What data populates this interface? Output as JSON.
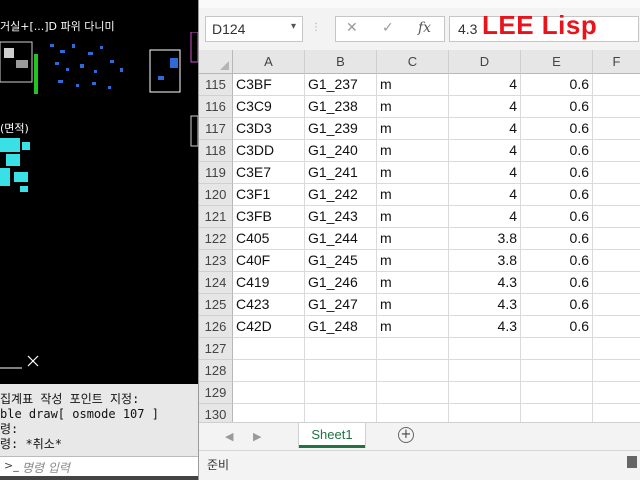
{
  "cad": {
    "top_label": "거실+[...]D 파위 다니미",
    "label2": "(면적)",
    "command_lines": [
      " 집계표 작성 포인트 지정:",
      "ble draw[ osmode 107 ]",
      "령:",
      "령: *취소*"
    ],
    "command_placeholder": "명령 입력",
    "command_icon": ">_",
    "close_icon_glyph": "✕"
  },
  "excel": {
    "name_box": "D124",
    "formula_value": "4.3",
    "watermark": "LEE Lisp",
    "columns": [
      "A",
      "B",
      "C",
      "D",
      "E",
      "F"
    ],
    "rows": [
      {
        "num": "115",
        "a": "C3BF",
        "b": "G1_237",
        "c": "m",
        "d": "4",
        "e": "0.6"
      },
      {
        "num": "116",
        "a": "C3C9",
        "b": "G1_238",
        "c": "m",
        "d": "4",
        "e": "0.6"
      },
      {
        "num": "117",
        "a": "C3D3",
        "b": "G1_239",
        "c": "m",
        "d": "4",
        "e": "0.6"
      },
      {
        "num": "118",
        "a": "C3DD",
        "b": "G1_240",
        "c": "m",
        "d": "4",
        "e": "0.6"
      },
      {
        "num": "119",
        "a": "C3E7",
        "b": "G1_241",
        "c": "m",
        "d": "4",
        "e": "0.6"
      },
      {
        "num": "120",
        "a": "C3F1",
        "b": "G1_242",
        "c": "m",
        "d": "4",
        "e": "0.6"
      },
      {
        "num": "121",
        "a": "C3FB",
        "b": "G1_243",
        "c": "m",
        "d": "4",
        "e": "0.6"
      },
      {
        "num": "122",
        "a": "C405",
        "b": "G1_244",
        "c": "m",
        "d": "3.8",
        "e": "0.6"
      },
      {
        "num": "123",
        "a": "C40F",
        "b": "G1_245",
        "c": "m",
        "d": "3.8",
        "e": "0.6"
      },
      {
        "num": "124",
        "a": "C419",
        "b": "G1_246",
        "c": "m",
        "d": "4.3",
        "e": "0.6"
      },
      {
        "num": "125",
        "a": "C423",
        "b": "G1_247",
        "c": "m",
        "d": "4.3",
        "e": "0.6"
      },
      {
        "num": "126",
        "a": "C42D",
        "b": "G1_248",
        "c": "m",
        "d": "4.3",
        "e": "0.6"
      },
      {
        "num": "127",
        "a": "",
        "b": "",
        "c": "",
        "d": "",
        "e": ""
      },
      {
        "num": "128",
        "a": "",
        "b": "",
        "c": "",
        "d": "",
        "e": ""
      },
      {
        "num": "129",
        "a": "",
        "b": "",
        "c": "",
        "d": "",
        "e": ""
      },
      {
        "num": "130",
        "a": "",
        "b": "",
        "c": "",
        "d": "",
        "e": ""
      }
    ],
    "sheet_tab": "Sheet1",
    "add_sheet": "+",
    "status": "준비",
    "accent_color": "#217346",
    "watermark_color": "#e8141c",
    "cancel_glyph": "✕",
    "enter_glyph": "✓",
    "fx_glyph": "fx"
  }
}
